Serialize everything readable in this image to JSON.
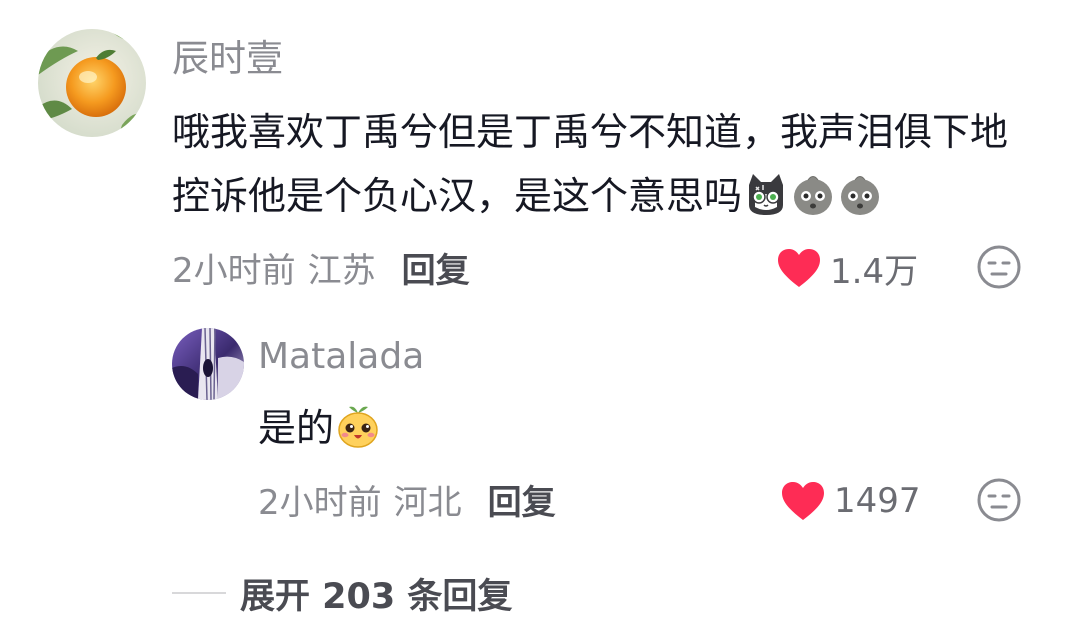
{
  "comment": {
    "author": "辰时壹",
    "text": "哦我喜欢丁禹兮但是丁禹兮不知道，我声泪俱下地控诉他是个负心汉，是这个意思吗",
    "emojis": [
      "cat-emoji",
      "crying-face-emoji",
      "crying-face-emoji"
    ],
    "time": "2小时前",
    "location": "江苏",
    "reply_label": "回复",
    "like_count": "1.4万",
    "liked": true
  },
  "reply": {
    "author": "Matalada",
    "text": "是的",
    "emoji": "sprout-face-emoji",
    "time": "2小时前",
    "location": "河北",
    "reply_label": "回复",
    "like_count": "1497",
    "liked": true
  },
  "expand": {
    "label": "展开 203 条回复"
  },
  "colors": {
    "like_red": "#fe2c55",
    "secondary_text": "#8a8b91",
    "primary_text": "#161823"
  }
}
